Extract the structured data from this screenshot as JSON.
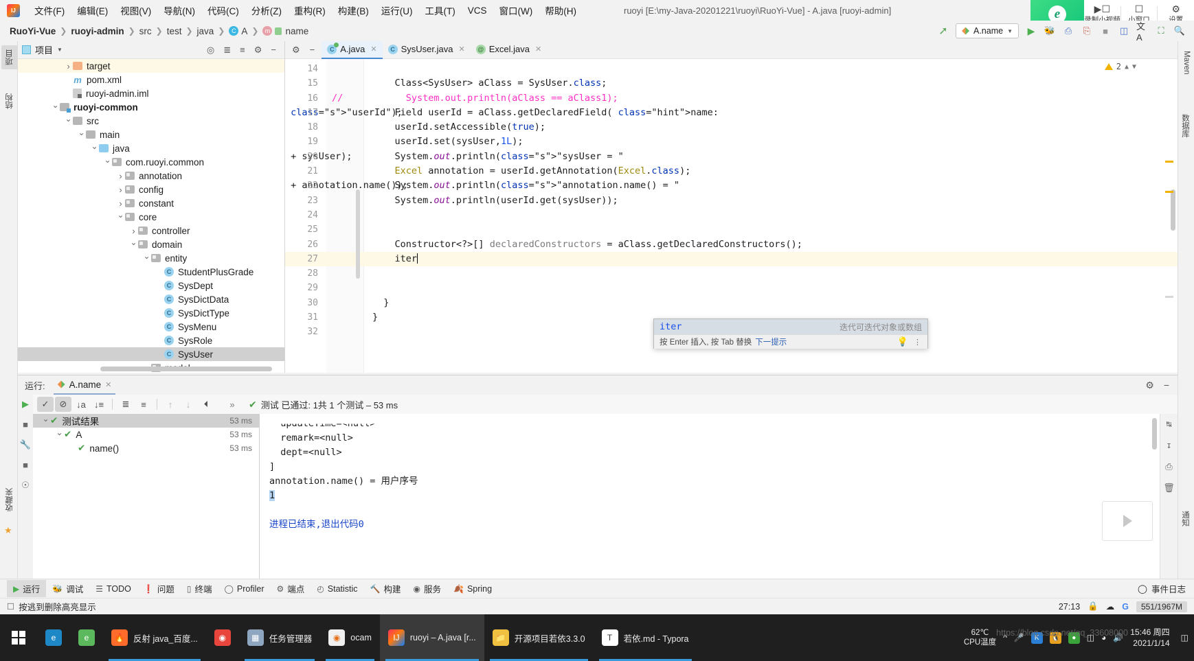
{
  "menubar": {
    "logo": "intellij-logo",
    "items": [
      "文件(F)",
      "编辑(E)",
      "视图(V)",
      "导航(N)",
      "代码(C)",
      "分析(Z)",
      "重构(R)",
      "构建(B)",
      "运行(U)",
      "工具(T)",
      "VCS",
      "窗口(W)",
      "帮助(H)"
    ],
    "window_title": "ruoyi [E:\\my-Java-20201221\\ruoyi\\RuoYi-Vue] - A.java [ruoyi-admin]"
  },
  "recorder_overlay": {
    "brand": "e",
    "buttons": [
      {
        "label": "录制小视频",
        "icon": "video-record-icon"
      },
      {
        "label": "小窗口",
        "icon": "mini-window-icon"
      },
      {
        "label": "设置",
        "icon": "gear-icon"
      }
    ]
  },
  "navbar": {
    "breadcrumb": [
      "RuoYi-Vue",
      "ruoyi-admin",
      "src",
      "test",
      "java",
      "A",
      "name"
    ],
    "run_config": "A.name",
    "actions": [
      "back-arrow",
      "run",
      "debug",
      "coverage",
      "profile",
      "stop",
      "layout",
      "translate",
      "screenshot",
      "search"
    ]
  },
  "left_tool_strip": [
    {
      "label": "项目",
      "selected": true
    },
    {
      "label": "结构",
      "selected": false
    },
    {
      "label": "收藏夹",
      "selected": false
    }
  ],
  "right_tool_strip": [
    {
      "label": "Maven"
    },
    {
      "label": "数据库"
    },
    {
      "label": "通知"
    }
  ],
  "project_panel": {
    "title": "项目",
    "toolbar_icons": [
      "locate-icon",
      "expand-all-icon",
      "collapse-all-icon",
      "gear-icon",
      "minimize-icon"
    ],
    "tree": [
      {
        "depth": 3,
        "arrow": "right",
        "icon": "folder-orange",
        "label": "target",
        "highlight": "yellow"
      },
      {
        "depth": 3,
        "arrow": "none",
        "icon": "maven-file",
        "label": "pom.xml"
      },
      {
        "depth": 3,
        "arrow": "none",
        "icon": "iml-file",
        "label": "ruoyi-admin.iml"
      },
      {
        "depth": 2,
        "arrow": "down",
        "icon": "module",
        "label": "ruoyi-common",
        "bold": true
      },
      {
        "depth": 3,
        "arrow": "down",
        "icon": "folder",
        "label": "src"
      },
      {
        "depth": 4,
        "arrow": "down",
        "icon": "folder",
        "label": "main"
      },
      {
        "depth": 5,
        "arrow": "down",
        "icon": "folder-source",
        "label": "java"
      },
      {
        "depth": 6,
        "arrow": "down",
        "icon": "package",
        "label": "com.ruoyi.common"
      },
      {
        "depth": 7,
        "arrow": "right",
        "icon": "package",
        "label": "annotation"
      },
      {
        "depth": 7,
        "arrow": "right",
        "icon": "package",
        "label": "config"
      },
      {
        "depth": 7,
        "arrow": "right",
        "icon": "package",
        "label": "constant"
      },
      {
        "depth": 7,
        "arrow": "down",
        "icon": "package",
        "label": "core"
      },
      {
        "depth": 8,
        "arrow": "right",
        "icon": "package",
        "label": "controller"
      },
      {
        "depth": 8,
        "arrow": "down",
        "icon": "package",
        "label": "domain"
      },
      {
        "depth": 9,
        "arrow": "down",
        "icon": "package",
        "label": "entity"
      },
      {
        "depth": 10,
        "arrow": "none",
        "icon": "class",
        "label": "StudentPlusGrade"
      },
      {
        "depth": 10,
        "arrow": "none",
        "icon": "class",
        "label": "SysDept"
      },
      {
        "depth": 10,
        "arrow": "none",
        "icon": "class",
        "label": "SysDictData"
      },
      {
        "depth": 10,
        "arrow": "none",
        "icon": "class",
        "label": "SysDictType"
      },
      {
        "depth": 10,
        "arrow": "none",
        "icon": "class",
        "label": "SysMenu"
      },
      {
        "depth": 10,
        "arrow": "none",
        "icon": "class",
        "label": "SysRole"
      },
      {
        "depth": 10,
        "arrow": "none",
        "icon": "class",
        "label": "SysUser",
        "selected": true
      },
      {
        "depth": 9,
        "arrow": "right",
        "icon": "package",
        "label": "model"
      }
    ]
  },
  "editor": {
    "tabs": [
      {
        "label": "A.java",
        "icon": "class-runnable-icon",
        "active": true
      },
      {
        "label": "SysUser.java",
        "icon": "class-icon",
        "active": false
      },
      {
        "label": "Excel.java",
        "icon": "annotation-icon",
        "active": false
      }
    ],
    "warning_count": "2",
    "lines": [
      {
        "n": "14",
        "text": ""
      },
      {
        "n": "15",
        "text": "    Class<SysUser> aClass = SysUser.class;"
      },
      {
        "n": "16",
        "text": "      System.out.println(aClass == aClass1);",
        "comment": true,
        "marker": "//"
      },
      {
        "n": "17",
        "text": "    Field userId = aClass.getDeclaredField( name: \"userId\");"
      },
      {
        "n": "18",
        "text": "    userId.setAccessible(true);"
      },
      {
        "n": "19",
        "text": "    userId.set(sysUser,1L);"
      },
      {
        "n": "20",
        "text": "    System.out.println(\"sysUser = \" + sysUser);"
      },
      {
        "n": "21",
        "text": "    Excel annotation = userId.getAnnotation(Excel.class);"
      },
      {
        "n": "22",
        "text": "    System.out.println(\"annotation.name() = \" + annotation.name());"
      },
      {
        "n": "23",
        "text": "    System.out.println(userId.get(sysUser));"
      },
      {
        "n": "24",
        "text": ""
      },
      {
        "n": "25",
        "text": ""
      },
      {
        "n": "26",
        "text": "    Constructor<?>[] declaredConstructors = aClass.getDeclaredConstructors();"
      },
      {
        "n": "27",
        "text": "    iter",
        "current": true
      },
      {
        "n": "28",
        "text": ""
      },
      {
        "n": "29",
        "text": ""
      },
      {
        "n": "30",
        "text": "  }"
      },
      {
        "n": "31",
        "text": "}"
      },
      {
        "n": "32",
        "text": ""
      }
    ],
    "autocomplete": {
      "entry": "iter",
      "description": "迭代可迭代对象或数组",
      "hint_prefix": "按 Enter 插入, 按 Tab 替换",
      "hint_link": "下一提示"
    }
  },
  "run_panel": {
    "label": "运行:",
    "tab": "A.name",
    "toolbar": [
      "rerun-icon",
      "show-passed-icon",
      "hide-ignored-icon",
      "sort-alpha-icon",
      "sort-duration-icon",
      "expand-all-icon",
      "collapse-all-icon",
      "prev-failed-icon",
      "next-failed-icon",
      "history-icon",
      "more-icon"
    ],
    "status_text": "测试 已通过: 1共 1 个测试 – 53 ms",
    "status_parts": {
      "prefix": "测试 已通过:",
      "passed": "1",
      "total": "共 1 个测试",
      "duration": "– 53 ms"
    },
    "tree": [
      {
        "depth": 0,
        "arrow": "down",
        "label": "测试结果",
        "time": "53 ms",
        "selected": true
      },
      {
        "depth": 1,
        "arrow": "down",
        "label": "A",
        "time": "53 ms"
      },
      {
        "depth": 2,
        "arrow": "none",
        "label": "name()",
        "time": "53 ms"
      }
    ],
    "console": [
      {
        "text": "  updateTime=<null>",
        "clipped": true
      },
      {
        "text": "  remark=<null>"
      },
      {
        "text": "  dept=<null>"
      },
      {
        "text": "]"
      },
      {
        "text": "annotation.name() = 用户序号"
      },
      {
        "text": "1",
        "highlight": true
      },
      {
        "text": ""
      },
      {
        "text": "进程已结束,退出代码0",
        "color": "blue"
      }
    ],
    "side_icons": [
      "rerun-icon",
      "stop-icon",
      "settings-icon",
      "pin-icon",
      "camera-icon"
    ],
    "console_right_icons": [
      "wrap-icon",
      "scroll-end-icon",
      "print-icon",
      "clear-icon"
    ]
  },
  "bottom_toolbar": {
    "items": [
      {
        "label": "运行",
        "icon": "run-icon",
        "selected": true
      },
      {
        "label": "调试",
        "icon": "debug-icon"
      },
      {
        "label": "TODO",
        "icon": "todo-icon"
      },
      {
        "label": "问题",
        "icon": "problems-icon"
      },
      {
        "label": "终端",
        "icon": "terminal-icon"
      },
      {
        "label": "Profiler",
        "icon": "profiler-icon"
      },
      {
        "label": "端点",
        "icon": "endpoints-icon"
      },
      {
        "label": "Statistic",
        "icon": "statistic-icon"
      },
      {
        "label": "构建",
        "icon": "build-icon"
      },
      {
        "label": "服务",
        "icon": "services-icon"
      },
      {
        "label": "Spring",
        "icon": "spring-icon"
      }
    ],
    "event_log": "事件日志"
  },
  "status_bar": {
    "message": "按逃到删除高亮显示",
    "caret": "27:13",
    "icons": [
      "lock-icon",
      "cloud-icon",
      "google-icon"
    ],
    "memory": "551/1967M"
  },
  "taskbar": {
    "start": "windows-start-icon",
    "items": [
      {
        "label": "",
        "icon": "edge-icon",
        "open": false
      },
      {
        "label": "",
        "icon": "360-browser-icon",
        "open": false
      },
      {
        "label": "反射 java_百度...",
        "icon": "firefox-icon",
        "open": true
      },
      {
        "label": "",
        "icon": "chrome-icon",
        "open": false
      },
      {
        "label": "任务管理器",
        "icon": "taskmgr-icon",
        "open": true
      },
      {
        "label": "ocam",
        "icon": "ocam-icon",
        "open": true
      },
      {
        "label": "ruoyi – A.java [r...",
        "icon": "intellij-icon",
        "open": true,
        "active": true
      },
      {
        "label": "开源项目若依3.3.0",
        "icon": "folder-icon",
        "open": true
      },
      {
        "label": "若依.md - Typora",
        "icon": "typora-icon",
        "open": true
      }
    ],
    "cpu_temp_value": "62℃",
    "cpu_temp_label": "CPU温度",
    "tray_icons": [
      "chevron-up-icon",
      "mic-icon",
      "kingsoft-icon",
      "qq-icon",
      "safety-icon",
      "battery-icon",
      "network-icon",
      "volume-icon"
    ],
    "clock_time": "15:46 周四",
    "clock_date": "2021/1/14",
    "watermark": "https://blog.csdn.net/qq_33608000"
  }
}
